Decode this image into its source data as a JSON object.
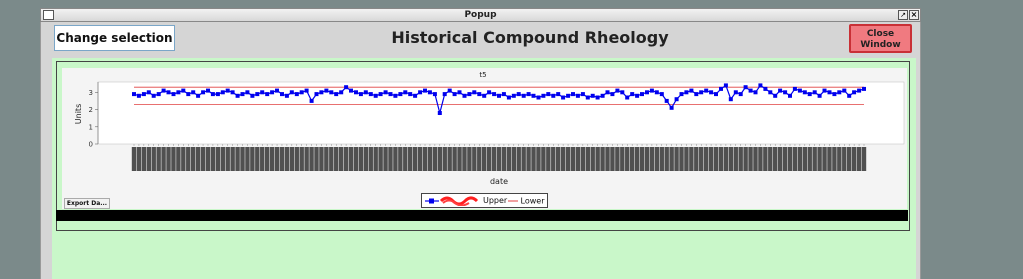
{
  "window": {
    "title": "Popup"
  },
  "toolbar": {
    "change_selection_label": "Change selection",
    "page_title": "Historical Compound Rheology",
    "close_line1": "Close",
    "close_line2": "Window"
  },
  "export_label": "Export Da...",
  "colors": {
    "series": "#0000ee",
    "limits": "#e04040",
    "panel": "#c9f7c9",
    "close_button": "#f07a80"
  },
  "chart_data": {
    "type": "line",
    "title": "t5",
    "xlabel": "date",
    "ylabel": "Units",
    "ylim": [
      0,
      3.6
    ],
    "yticks": [
      0,
      1,
      2,
      3
    ],
    "grid": false,
    "legend_position": "bottom",
    "limits": {
      "upper": 3.3,
      "lower": 2.3
    },
    "series": [
      {
        "name": "",
        "role": "measurement",
        "values": [
          2.9,
          2.8,
          2.9,
          3.0,
          2.8,
          2.9,
          3.1,
          3.0,
          2.9,
          3.0,
          3.1,
          2.9,
          3.0,
          2.8,
          3.0,
          3.1,
          2.9,
          2.9,
          3.0,
          3.1,
          3.0,
          2.8,
          2.9,
          3.0,
          2.8,
          2.9,
          3.0,
          2.9,
          3.0,
          3.1,
          2.9,
          2.8,
          3.0,
          2.9,
          3.0,
          3.1,
          2.5,
          2.9,
          3.0,
          3.1,
          3.0,
          2.9,
          3.0,
          3.3,
          3.1,
          3.0,
          2.9,
          3.0,
          2.9,
          2.8,
          2.9,
          3.0,
          2.9,
          2.8,
          2.9,
          3.0,
          2.9,
          2.8,
          3.0,
          3.1,
          3.0,
          2.9,
          1.8,
          2.9,
          3.1,
          2.9,
          3.0,
          2.8,
          2.9,
          3.0,
          2.9,
          2.8,
          3.0,
          2.9,
          2.8,
          2.9,
          2.7,
          2.8,
          2.9,
          2.8,
          2.9,
          2.8,
          2.7,
          2.8,
          2.9,
          2.8,
          2.9,
          2.7,
          2.8,
          2.9,
          2.8,
          2.9,
          2.7,
          2.8,
          2.7,
          2.8,
          3.0,
          2.9,
          3.1,
          3.0,
          2.7,
          2.9,
          2.8,
          2.9,
          3.0,
          3.1,
          3.0,
          2.9,
          2.5,
          2.1,
          2.6,
          2.9,
          3.0,
          3.1,
          2.9,
          3.0,
          3.1,
          3.0,
          2.9,
          3.2,
          3.4,
          2.6,
          3.0,
          2.9,
          3.3,
          3.1,
          3.0,
          3.4,
          3.2,
          3.0,
          2.8,
          3.1,
          3.0,
          2.8,
          3.2,
          3.1,
          3.0,
          2.9,
          3.0,
          2.8,
          3.1,
          3.0,
          2.9,
          3.0,
          3.1,
          2.8,
          3.0,
          3.1,
          3.2
        ]
      },
      {
        "name": "Upper",
        "role": "upper"
      },
      {
        "name": "Lower",
        "role": "lower"
      }
    ]
  }
}
